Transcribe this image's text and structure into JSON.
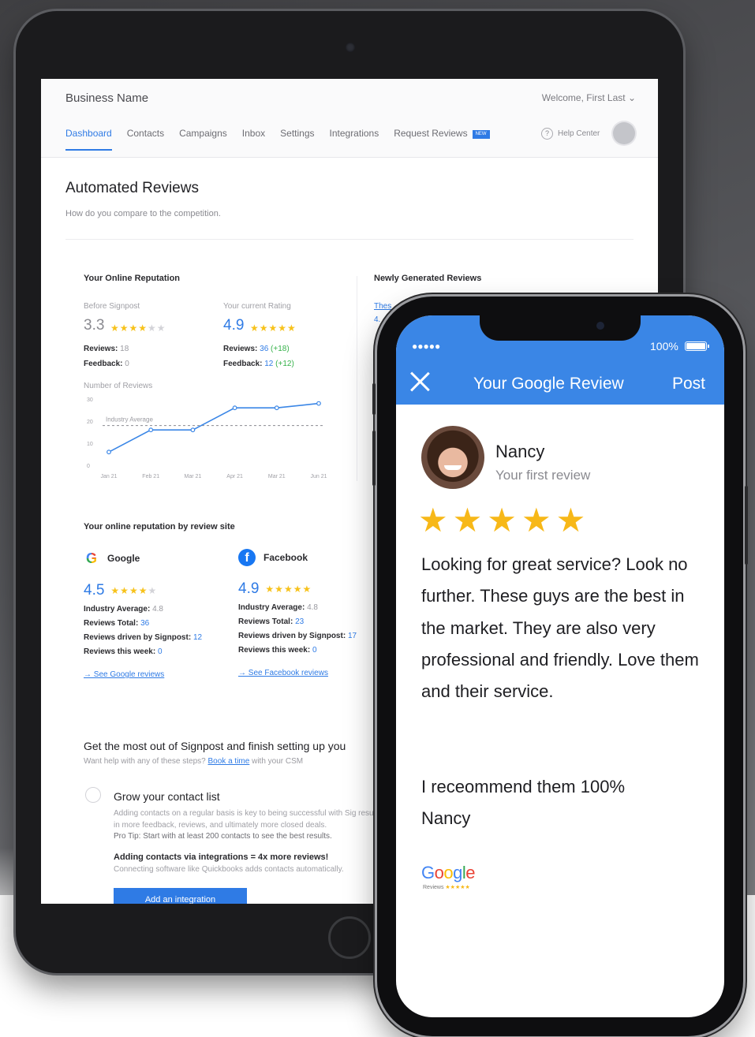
{
  "tablet": {
    "business_name": "Business Name",
    "welcome": "Welcome, First Last",
    "nav": [
      "Dashboard",
      "Contacts",
      "Campaigns",
      "Inbox",
      "Settings",
      "Integrations",
      "Request Reviews"
    ],
    "nav_active": "Dashboard",
    "new_badge": "NEW",
    "help_center": "Help Center",
    "page_title": "Automated Reviews",
    "page_subtitle": "How do you compare to the competition.",
    "reputation": {
      "title": "Your Online Reputation",
      "before_label": "Before Signpost",
      "before_rating": "3.3",
      "before_reviews_label": "Reviews:",
      "before_reviews": "18",
      "before_feedback_label": "Feedback:",
      "before_feedback": "0",
      "current_label": "Your current Rating",
      "current_rating": "4.9",
      "current_reviews_label": "Reviews:",
      "current_reviews": "36",
      "current_reviews_delta": "(+18)",
      "current_feedback_label": "Feedback:",
      "current_feedback": "12",
      "current_feedback_delta": "(+12)"
    },
    "newly": {
      "title": "Newly Generated Reviews",
      "link": "Thes",
      "value": "4."
    },
    "by_site": {
      "title": "Your online reputation by review site",
      "google": {
        "name": "Google",
        "rating": "4.5",
        "industry_label": "Industry Average:",
        "industry_value": "4.8",
        "total_label": "Reviews Total:",
        "total_value": "36",
        "driven_label": "Reviews driven by Signpost:",
        "driven_value": "12",
        "week_label": "Reviews this week:",
        "week_value": "0",
        "link": "→ See Google reviews"
      },
      "facebook": {
        "name": "Facebook",
        "rating": "4.9",
        "industry_label": "Industry Average:",
        "industry_value": "4.8",
        "total_label": "Reviews Total:",
        "total_value": "23",
        "driven_label": "Reviews driven by Signpost:",
        "driven_value": "17",
        "week_label": "Reviews this week:",
        "week_value": "0",
        "link": "→ See Facebook reviews"
      }
    },
    "setup": {
      "title": "Get the most out of Signpost and finish setting up you",
      "sub_before": "Want help with any of these steps?",
      "sub_link": "Book a time",
      "sub_after": "with your CSM",
      "grow_title": "Grow your contact list",
      "grow_text": "Adding contacts on a regular basis is key to being successful with Sig results in more feedback, reviews, and ultimately more closed deals.",
      "pro_tip": "Pro Tip: Start with at least 200 contacts to see the best results.",
      "adding_title": "Adding contacts via integrations = 4x more reviews!",
      "adding_sub": "Connecting software like Quickbooks adds contacts automatically.",
      "button": "Add an integration"
    }
  },
  "chart_data": {
    "type": "line",
    "title": "Number of Reviews",
    "categories": [
      "Jan 21",
      "Feb 21",
      "Mar 21",
      "Apr 21",
      "Mar 21",
      "Jun 21"
    ],
    "series": [
      {
        "name": "",
        "values": [
          6,
          16,
          16,
          26,
          26,
          28
        ],
        "color": "#3a86e6"
      }
    ],
    "reference_line": {
      "label": "Industry Average",
      "value": 18
    },
    "yticks": [
      "0",
      "10",
      "20",
      "30"
    ],
    "ylim": [
      0,
      30
    ]
  },
  "phone": {
    "signal": "●●●●●",
    "battery": "100%",
    "header_title": "Your Google Review",
    "post": "Post",
    "reviewer_name": "Nancy",
    "reviewer_sub": "Your first review",
    "stars": "★★★★★",
    "review_text": "Looking for great service? Look no further. These guys are the best in the market. They are also very professional and friendly. Love them and their service.",
    "recommend": "I receommend them 100%",
    "sign": "Nancy",
    "google_letters": [
      "G",
      "o",
      "o",
      "g",
      "l",
      "e"
    ],
    "google_sub": "Reviews",
    "header_color": "#3a86e6"
  }
}
